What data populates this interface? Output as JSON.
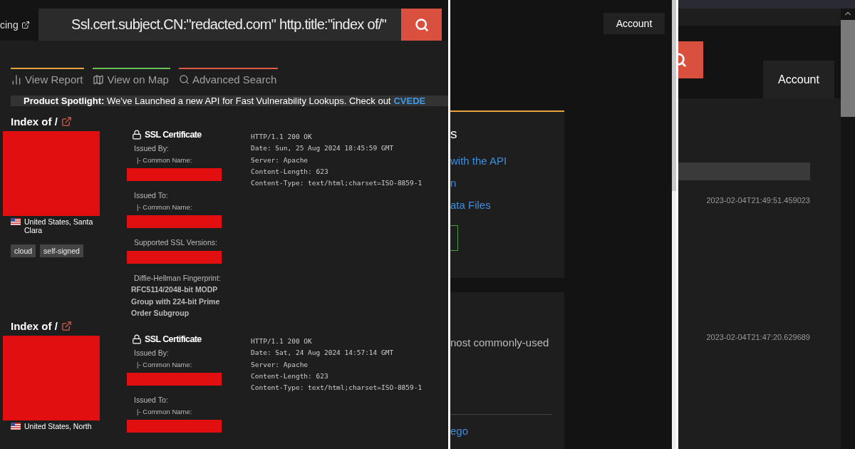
{
  "left_pane": {
    "top_link": "cing",
    "search": {
      "value": "Ssl.cert.subject.CN:\"redacted.com\" http.title:\"index of/\""
    },
    "tabs": [
      {
        "label": "View Report",
        "kind": "report",
        "color": "#e8a33d"
      },
      {
        "label": "View on Map",
        "kind": "map",
        "color": "#6bbf59"
      },
      {
        "label": "Advanced Search",
        "kind": "search",
        "color": "#e05a47"
      }
    ],
    "banner": {
      "text": "**Product Spotlight:** We've Launched a new API for Fast Vulnerability Lookups. Check out",
      "link": "CVEDE"
    },
    "results": [
      {
        "title": "Index of /",
        "screenshot_redacted": true,
        "location": "United States, Santa Clara",
        "tags": [
          "cloud",
          "self-signed"
        ],
        "ssl_heading": "SSL Certificate",
        "ssl_fields": [
          {
            "kind": "label",
            "text": "Issued By:"
          },
          {
            "kind": "sublabel",
            "text": "|- Common Name:"
          },
          {
            "kind": "redacted"
          },
          {
            "kind": "label",
            "text": "Issued To:"
          },
          {
            "kind": "sublabel",
            "text": "|- Common Name:"
          },
          {
            "kind": "redacted"
          },
          {
            "kind": "label",
            "text": "Supported SSL Versions:"
          },
          {
            "kind": "redacted"
          },
          {
            "kind": "label",
            "text": "Diffie-Hellman Fingerprint:"
          },
          {
            "kind": "value",
            "text": "RFC5114/2048-bit MODP Group with 224-bit Prime Order Subgroup"
          }
        ],
        "headers": [
          "HTTP/1.1 200 OK",
          "Date: Sun, 25 Aug 2024 18:45:59 GMT",
          "Server: Apache",
          "Content-Length: 623",
          "Content-Type: text/html;charset=ISO-8859-1"
        ]
      },
      {
        "title": "Index of /",
        "screenshot_redacted": true,
        "location": "United States, North",
        "ssl_heading": "SSL Certificate",
        "ssl_fields": [
          {
            "kind": "label",
            "text": "Issued By:"
          },
          {
            "kind": "sublabel",
            "text": "|- Common Name:"
          },
          {
            "kind": "redacted"
          },
          {
            "kind": "label",
            "text": "Issued To:"
          },
          {
            "kind": "sublabel",
            "text": "|- Common Name:"
          },
          {
            "kind": "redacted"
          }
        ],
        "headers": [
          "HTTP/1.1 200 OK",
          "Date: Sat, 24 Aug 2024 14:57:14 GMT",
          "Server: Apache",
          "Content-Length: 623",
          "Content-Type: text/html;charset=ISO-8859-1"
        ]
      }
    ]
  },
  "middle_pane": {
    "account_button": "Account",
    "card_1": {
      "heading": "s",
      "links": [
        "with the API",
        "n",
        "ata Files"
      ]
    },
    "card_2": {
      "text": "nost commonly-used",
      "link": "ego"
    }
  },
  "right_pane": {
    "account_button": "Account",
    "timestamps": [
      "2023-02-04T21:49:51.459023",
      "2023-02-04T21:47:20.629689"
    ]
  }
}
